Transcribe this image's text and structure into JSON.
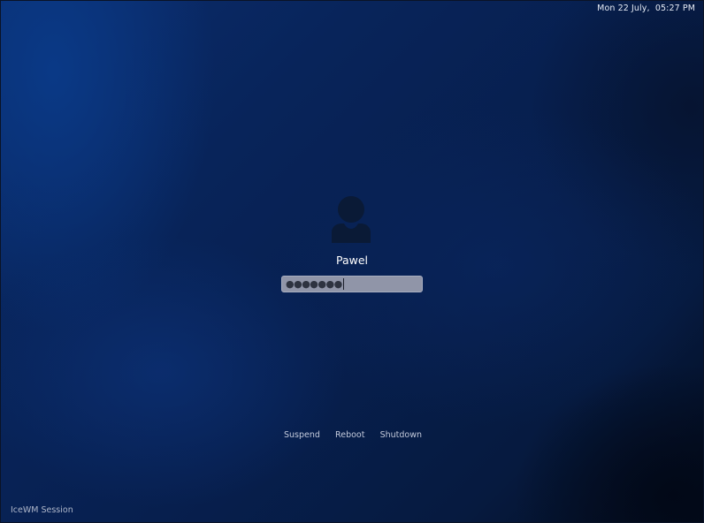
{
  "clock": {
    "text": "Mon 22 July,  05:27 PM"
  },
  "user": {
    "name": "Pawel",
    "avatar_icon": "user-silhouette-icon"
  },
  "password": {
    "masked_value": "●●●●●●●"
  },
  "actions": {
    "suspend": "Suspend",
    "reboot": "Reboot",
    "shutdown": "Shutdown"
  },
  "session": {
    "label": "IceWM Session"
  },
  "colors": {
    "background": "#061a3a",
    "avatar": "#0a1a36",
    "password_field": "#9095a8"
  }
}
